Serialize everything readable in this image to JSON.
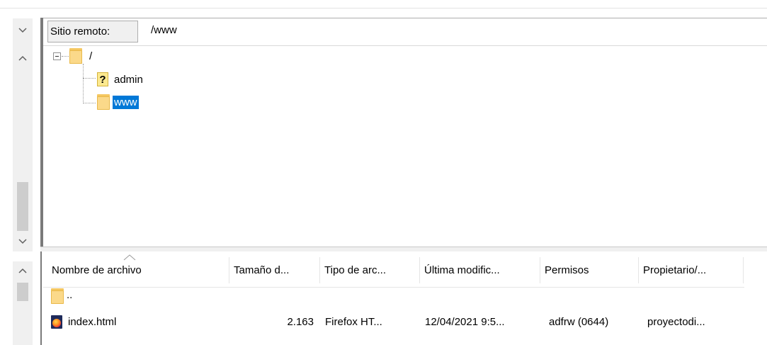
{
  "remote_site": {
    "label": "Sitio remoto:",
    "path": "/www"
  },
  "tree": {
    "root": {
      "label": "/",
      "icon": "folder-icon"
    },
    "children": [
      {
        "label": "admin",
        "icon": "unknown-folder-icon",
        "selected": false
      },
      {
        "label": "www",
        "icon": "folder-icon",
        "selected": true
      }
    ]
  },
  "file_list": {
    "columns": [
      "Nombre de archivo",
      "Tamaño d...",
      "Tipo de arc...",
      "Última modific...",
      "Permisos",
      "Propietario/..."
    ],
    "rows": [
      {
        "name": "..",
        "size": "",
        "type": "",
        "modified": "",
        "perms": "",
        "owner": "",
        "icon": "folder-icon"
      },
      {
        "name": "index.html",
        "size": "2.163",
        "type": "Firefox HT...",
        "modified": "12/04/2021 9:5...",
        "perms": "adfrw (0644)",
        "owner": "proyectodi...",
        "icon": "firefox-html-icon"
      }
    ]
  },
  "colors": {
    "selection": "#0078d7",
    "folder": "#fbd98a"
  }
}
